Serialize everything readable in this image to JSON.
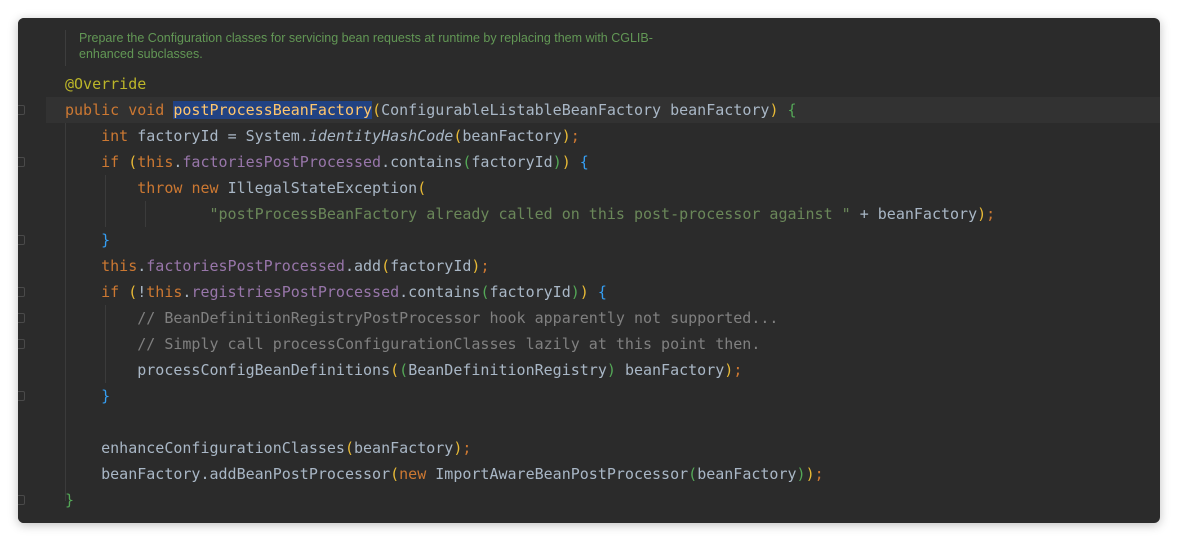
{
  "doc_comment": {
    "line1": "Prepare the Configuration classes for servicing bean requests at runtime by replacing them with CGLIB-",
    "line2": "enhanced subclasses."
  },
  "code": {
    "l1": {
      "annotation": "@Override"
    },
    "l2": {
      "kw_public": "public",
      "kw_void": "void",
      "method": "postProcessBeanFactory",
      "p_open": "(",
      "type": "ConfigurableListableBeanFactory",
      "param": "beanFactory",
      "p_close": ")",
      "brace": "{"
    },
    "l3": {
      "kw_int": "int",
      "var": "factoryId",
      "eq": "=",
      "cls": "System.",
      "call": "identityHashCode",
      "p_open": "(",
      "arg": "beanFactory",
      "p_close": ")",
      "semi": ";"
    },
    "l4": {
      "kw_if": "if",
      "p_open": "(",
      "kw_this": "this",
      "dot": ".",
      "field": "factoriesPostProcessed",
      "method": ".contains",
      "p2_open": "(",
      "arg": "factoryId",
      "p2_close": ")",
      "p_close": ")",
      "brace": "{"
    },
    "l5": {
      "kw_throw": "throw",
      "kw_new": "new",
      "cls": "IllegalStateException",
      "p_open": "("
    },
    "l6": {
      "str": "\"postProcessBeanFactory already called on this post-processor against \"",
      "plus": "+",
      "arg": "beanFactory",
      "p_close": ")",
      "semi": ";"
    },
    "l7": {
      "brace": "}"
    },
    "l8": {
      "kw_this": "this",
      "dot": ".",
      "field": "factoriesPostProcessed",
      "method": ".add",
      "p_open": "(",
      "arg": "factoryId",
      "p_close": ")",
      "semi": ";"
    },
    "l9": {
      "kw_if": "if",
      "p_open": "(",
      "not": "!",
      "kw_this": "this",
      "dot": ".",
      "field": "registriesPostProcessed",
      "method": ".contains",
      "p2_open": "(",
      "arg": "factoryId",
      "p2_close": ")",
      "p_close": ")",
      "brace": "{"
    },
    "l10": {
      "comment": "// BeanDefinitionRegistryPostProcessor hook apparently not supported..."
    },
    "l11": {
      "comment": "// Simply call processConfigurationClasses lazily at this point then."
    },
    "l12": {
      "method": "processConfigBeanDefinitions",
      "p_open": "(",
      "p2_open": "(",
      "type": "BeanDefinitionRegistry",
      "p2_close": ")",
      "arg": "beanFactory",
      "p_close": ")",
      "semi": ";"
    },
    "l13": {
      "brace": "}"
    },
    "l15": {
      "method": "enhanceConfigurationClasses",
      "p_open": "(",
      "arg": "beanFactory",
      "p_close": ")",
      "semi": ";"
    },
    "l16": {
      "obj": "beanFactory",
      "method": ".addBeanPostProcessor",
      "p_open": "(",
      "kw_new": "new",
      "cls": "ImportAwareBeanPostProcessor",
      "p2_open": "(",
      "arg": "beanFactory",
      "p2_close": ")",
      "p_close": ")",
      "semi": ";"
    },
    "l17": {
      "brace": "}"
    }
  },
  "colors": {
    "background": "#2b2b2b",
    "keyword": "#cc7832",
    "annotation": "#bbb529",
    "method_declaration": "#ffc66d",
    "field": "#9876aa",
    "string": "#6a8759",
    "comment": "#808080",
    "doc_comment": "#629755",
    "plain": "#a9b7c6"
  }
}
